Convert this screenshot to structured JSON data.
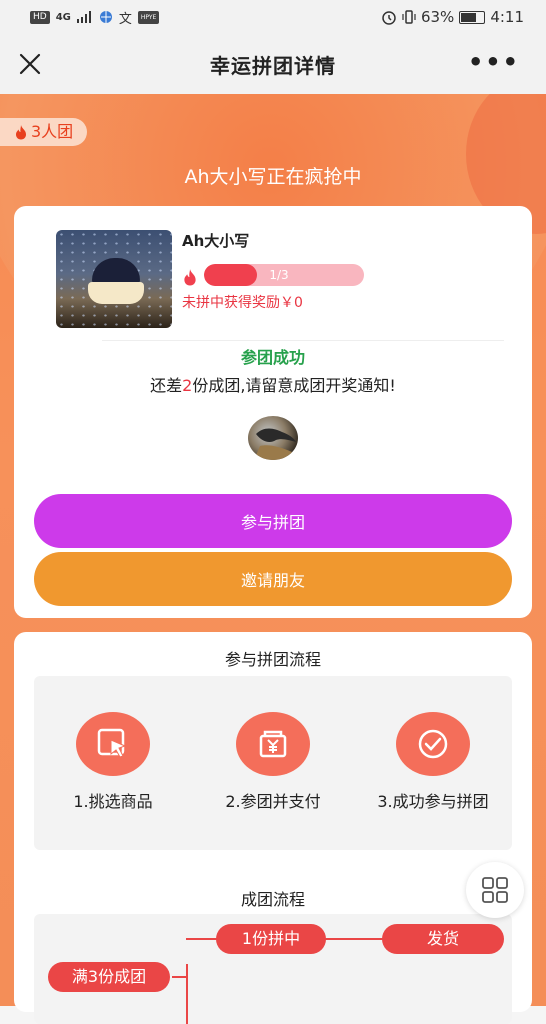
{
  "status_bar": {
    "left_tags": [
      "HD",
      "4G",
      "HPYE"
    ],
    "battery": "63%",
    "time": "4:11",
    "battery_level": 0.63
  },
  "nav": {
    "title": "幸运拼团详情",
    "more": "•••"
  },
  "hero": {
    "team_badge": "3人团",
    "title": "Ah大小写正在疯抢中"
  },
  "group": {
    "user_name": "Ah大小写",
    "progress_label": "1/3",
    "progress_fraction": 0.333,
    "reward_text": "未拼中获得奖励￥0",
    "success_text": "参团成功",
    "remain_prefix": "还差",
    "remain_count": "2",
    "remain_suffix": "份成团,请留意成团开奖通知!",
    "join_button": "参与拼团",
    "invite_button": "邀请朋友"
  },
  "process": {
    "title": "参与拼团流程",
    "steps": [
      {
        "label": "1.挑选商品",
        "icon": "cursor-select-icon"
      },
      {
        "label": "2.参团并支付",
        "icon": "yen-payment-icon"
      },
      {
        "label": "3.成功参与拼团",
        "icon": "check-circle-icon"
      }
    ]
  },
  "group_flow": {
    "title": "成团流程",
    "start": "满3份成团",
    "win": "1份拼中",
    "ship": "发货"
  },
  "colors": {
    "accent_red": "#ea4646",
    "join_purple": "#cd3aea",
    "invite_orange": "#f0982f",
    "success_green": "#27a14c",
    "step_circle": "#f46e5a"
  }
}
